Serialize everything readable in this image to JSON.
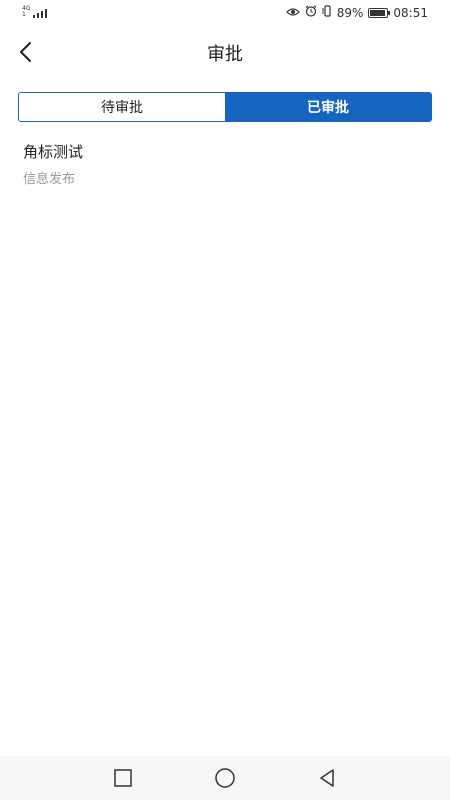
{
  "status_bar": {
    "network": [
      "4G",
      "1"
    ],
    "battery_percent": "89%",
    "battery_level": 0.89,
    "time": "08:51"
  },
  "header": {
    "title": "审批"
  },
  "tabs": [
    {
      "label": "待审批",
      "active": false
    },
    {
      "label": "已审批",
      "active": true
    }
  ],
  "list": [
    {
      "title": "角标测试",
      "subtitle": "信息发布"
    }
  ],
  "colors": {
    "accent": "#1565c0",
    "subtitle": "#999999"
  },
  "icons": {
    "back": "chevron-left-icon",
    "eye": "eye-icon",
    "alarm": "alarm-icon",
    "vibrate": "vibrate-icon",
    "battery": "battery-icon",
    "nav_recent": "square-icon",
    "nav_home": "circle-icon",
    "nav_back": "triangle-back-icon"
  }
}
